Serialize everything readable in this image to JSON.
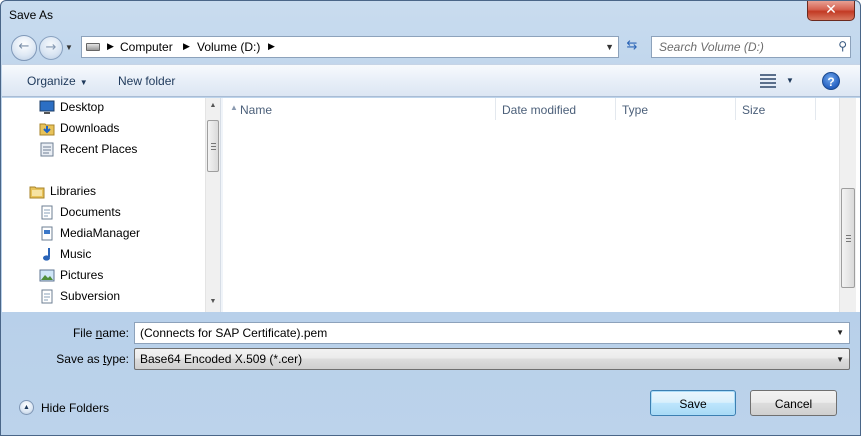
{
  "window": {
    "title": "Save As"
  },
  "address": {
    "crumbs": [
      "Computer",
      "Volume (D:)"
    ],
    "search_placeholder": "Search Volume (D:)"
  },
  "toolbar": {
    "organize_label": "Organize",
    "new_folder_label": "New folder"
  },
  "nav": {
    "favorites": [
      {
        "label": "Desktop",
        "icon": "desktop-icon"
      },
      {
        "label": "Downloads",
        "icon": "downloads-folder-icon"
      },
      {
        "label": "Recent Places",
        "icon": "recent-places-icon"
      }
    ],
    "libraries_label": "Libraries",
    "libraries": [
      {
        "label": "Documents",
        "icon": "documents-icon"
      },
      {
        "label": "MediaManager",
        "icon": "media-library-icon"
      },
      {
        "label": "Music",
        "icon": "music-icon"
      },
      {
        "label": "Pictures",
        "icon": "pictures-icon"
      },
      {
        "label": "Subversion",
        "icon": "subversion-icon"
      }
    ]
  },
  "list": {
    "columns": [
      "Name",
      "Date modified",
      "Type",
      "Size"
    ],
    "rows": []
  },
  "fields": {
    "filename_label_pre": "File ",
    "filename_label_u": "n",
    "filename_label_post": "ame:",
    "filename_value": "(Connects for SAP Certificate).pem",
    "type_label_pre": "Save as ",
    "type_label_u": "t",
    "type_label_post": "ype:",
    "type_value": "Base64 Encoded X.509 (*.cer)"
  },
  "footer": {
    "hide_folders_label": "Hide Folders",
    "save_label": "Save",
    "cancel_label": "Cancel"
  },
  "colors": {
    "frame": "#b4cde8",
    "toolbar": "#e8eff8",
    "close": "#c23a24",
    "link_text": "#1e395b",
    "help_blue": "#2661c1"
  }
}
